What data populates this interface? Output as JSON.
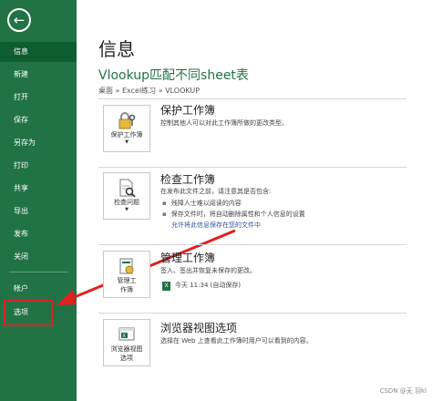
{
  "sidebar": {
    "back_glyph": "←",
    "items": [
      {
        "label": "信息"
      },
      {
        "label": "新建"
      },
      {
        "label": "打开"
      },
      {
        "label": "保存"
      },
      {
        "label": "另存为"
      },
      {
        "label": "打印"
      },
      {
        "label": "共享"
      },
      {
        "label": "导出"
      },
      {
        "label": "发布"
      },
      {
        "label": "关闭"
      },
      {
        "label": "帐户"
      },
      {
        "label": "选项"
      }
    ],
    "selected_index": 0,
    "bg_color": "#217346"
  },
  "main": {
    "title": "信息",
    "doc_title": "Vlookup匹配不同sheet表",
    "breadcrumb": "桌面 » Excel练习 » VLOOKUP",
    "sections": [
      {
        "button_label": "保护工作簿",
        "icon": "lock-key-icon",
        "title": "保护工作簿",
        "desc": "控制其他人可以对此工作簿所做的更改类型。"
      },
      {
        "button_label": "检查问题",
        "icon": "inspect-document-icon",
        "title": "检查工作簿",
        "desc": "在发布此文件之前，请注意其是否包含:",
        "bullets": [
          "残障人士难以阅读的内容",
          "保存文件时，将自动删除属性和个人信息的设置"
        ],
        "link": "允许将此信息保存在您的文件中"
      },
      {
        "button_label_1": "管理工",
        "button_label_2": "作簿",
        "icon": "manage-workbook-icon",
        "title": "管理工作簿",
        "desc": "签入、签出并恢复未保存的更改。",
        "version": "今天 11:34 (自动保存)"
      },
      {
        "button_label_1": "浏览器视图",
        "button_label_2": "选项",
        "icon": "browser-view-icon",
        "title": "浏览器视图选项",
        "desc": "选择在 Web 上查看此工作簿时用户可以看到的内容。"
      }
    ]
  },
  "annotation": {
    "color": "#e02020"
  },
  "watermark": "CSDN @无 羽kl"
}
